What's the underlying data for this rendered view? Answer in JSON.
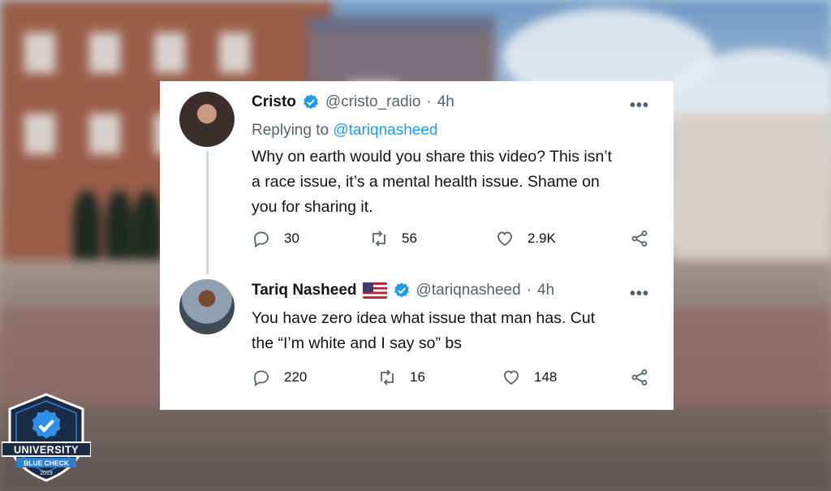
{
  "tweets": [
    {
      "name": "Cristo",
      "handle": "@cristo_radio",
      "time": "4h",
      "replying_prefix": "Replying to",
      "replying_to": "@tariqnasheed",
      "text": "Why on earth would you share this video? This isn’t a race issue, it’s a mental health issue. Shame on you for sharing it.",
      "text_lines": [
        "Why on earth would you share this video? This isn’t",
        "a race issue, it’s a mental health issue. Shame on",
        "you for sharing it."
      ],
      "replies": "30",
      "retweets": "56",
      "likes": "2.9K"
    },
    {
      "name": "Tariq Nasheed",
      "handle": "@tariqnasheed",
      "time": "4h",
      "text_lines": [
        "You have zero idea what issue that man has. Cut",
        "the “I’m white and I say so” bs"
      ],
      "replies": "220",
      "retweets": "16",
      "likes": "148"
    }
  ],
  "separator": "·",
  "more": "•••",
  "badge": {
    "line1": "UNIVERSITY",
    "line2": "BLUE CHECK",
    "year": "2019"
  },
  "colors": {
    "verified": "#1d9bf0",
    "text": "#0f1419",
    "muted": "#536471",
    "link": "#1d9bf0",
    "badge_navy": "#1c2b45"
  }
}
